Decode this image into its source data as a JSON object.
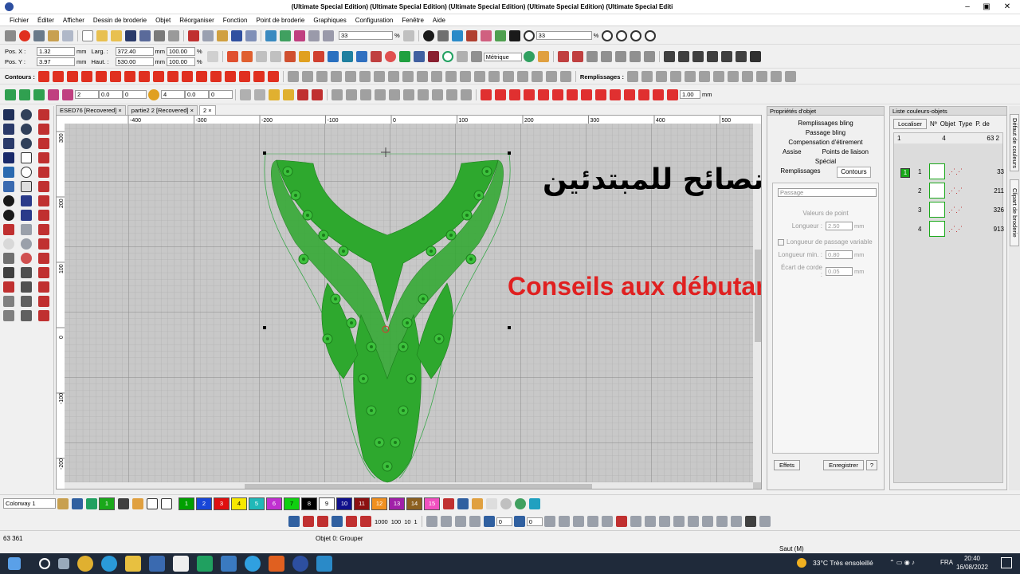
{
  "window": {
    "title": "(Ultimate Special Edition) (Ultimate Special Edition) (Ultimate Special Edition) (Ultimate Special Edition) (Ultimate Special Editi",
    "minimize": "–",
    "restore": "▣",
    "close": "✕"
  },
  "menu": [
    "Fichier",
    "Éditer",
    "Afficher",
    "Dessin de broderie",
    "Objet",
    "Réorganiser",
    "Fonction",
    "Point de broderie",
    "Graphiques",
    "Configuration",
    "Fenêtre",
    "Aide"
  ],
  "toolbar1": {
    "zoom_value": "33",
    "zoom_unit": "%",
    "zoom_value2": "33",
    "zoom_unit2": "%"
  },
  "position": {
    "pos_x_label": "Pos. X :",
    "pos_x": "1.32",
    "pos_y_label": "Pos. Y :",
    "pos_y": "3.97",
    "unit": "mm",
    "width_label": "Larg. :",
    "width": "372.40",
    "height_label": "Haut. :",
    "height": "530.00",
    "scale_w": "100.00",
    "scale_h": "100.00",
    "percent": "%",
    "units_select": "Métrique"
  },
  "row3": {
    "contours_label": "Contours :",
    "fills_label": "Remplissages :"
  },
  "row4": {
    "v1": "2",
    "v2": "0.0",
    "v3": "0",
    "v4": "4",
    "v5": "0.0",
    "v6": "0",
    "v7": "1.00",
    "unit": "mm"
  },
  "doc_tabs": [
    {
      "label": "ESED76 [Recovered]",
      "close": "×"
    },
    {
      "label": "partie2 2 [Recovered]",
      "close": "×"
    },
    {
      "label": "2",
      "close": "×"
    }
  ],
  "ruler": {
    "h": [
      "-400",
      "-300",
      "-200",
      "-100",
      "0",
      "100",
      "200",
      "300",
      "400",
      "500"
    ],
    "v": [
      "300",
      "200",
      "100",
      "0",
      "-100",
      "-200"
    ]
  },
  "overlay": {
    "arabic": "نصائح للمبتدئين",
    "french": "Conseils aux débutants"
  },
  "props": {
    "header": "Propriétés d'objet",
    "tabs_row1": [
      "Remplissages bling",
      "Passage bling",
      "Compensation d'étirement"
    ],
    "tabs_row2": [
      "Assise",
      "Points de liaison"
    ],
    "tab_special": "Spécial",
    "tab_fills": "Remplissages",
    "tab_contours": "Contours",
    "select": "Passage",
    "group_title": "Valeurs de point",
    "length_label": "Longueur :",
    "length_value": "2.50",
    "unit": "mm",
    "checkbox_label": "Longueur de passage variable",
    "min_label": "Longueur min. :",
    "min_value": "0.80",
    "chord_label": "Écart de corde :",
    "chord_value": "0.05",
    "effects_btn": "Effets",
    "save_btn": "Enregistrer",
    "help_btn": "?"
  },
  "colors_panel": {
    "header": "Liste couleurs-objets",
    "locate_btn": "Localiser",
    "cols": [
      "Nº",
      "Objet",
      "Type",
      "P. de"
    ],
    "group_num": "1",
    "group_count": "4",
    "group_val": "63 2",
    "group_tag": "1",
    "rows": [
      {
        "n": "1",
        "v": "33"
      },
      {
        "n": "2",
        "v": "211"
      },
      {
        "n": "3",
        "v": "326"
      },
      {
        "n": "4",
        "v": "913"
      }
    ]
  },
  "side_tabs": [
    "Défaut de couleurs",
    "Clipart de broderie"
  ],
  "palette": {
    "colorway": "Colorway 1",
    "swatches": [
      {
        "n": "1",
        "c": "#00a000"
      },
      {
        "n": "2",
        "c": "#1846d8"
      },
      {
        "n": "3",
        "c": "#e01010"
      },
      {
        "n": "4",
        "c": "#f8e800"
      },
      {
        "n": "5",
        "c": "#20b8b8"
      },
      {
        "n": "6",
        "c": "#c030d0"
      },
      {
        "n": "7",
        "c": "#10d010"
      },
      {
        "n": "8",
        "c": "#000000"
      },
      {
        "n": "9",
        "c": "#ffffff"
      },
      {
        "n": "10",
        "c": "#10108c"
      },
      {
        "n": "11",
        "c": "#8c1010"
      },
      {
        "n": "12",
        "c": "#f09020"
      },
      {
        "n": "13",
        "c": "#a020a8"
      },
      {
        "n": "14",
        "c": "#8c6020"
      },
      {
        "n": "15",
        "c": "#f050c0"
      }
    ]
  },
  "bottom_tools": {
    "v1": "1000",
    "v2": "100",
    "v3": "10",
    "v4": "1",
    "v5": "0",
    "v6": "0"
  },
  "status": {
    "stitches": "63 361",
    "object": "Objet 0: Grouper",
    "mode": "Saut (M)"
  },
  "taskbar": {
    "weather": "33°C  Très ensoleillé",
    "lang": "FRA",
    "time": "20:40",
    "date": "16/08/2022"
  }
}
